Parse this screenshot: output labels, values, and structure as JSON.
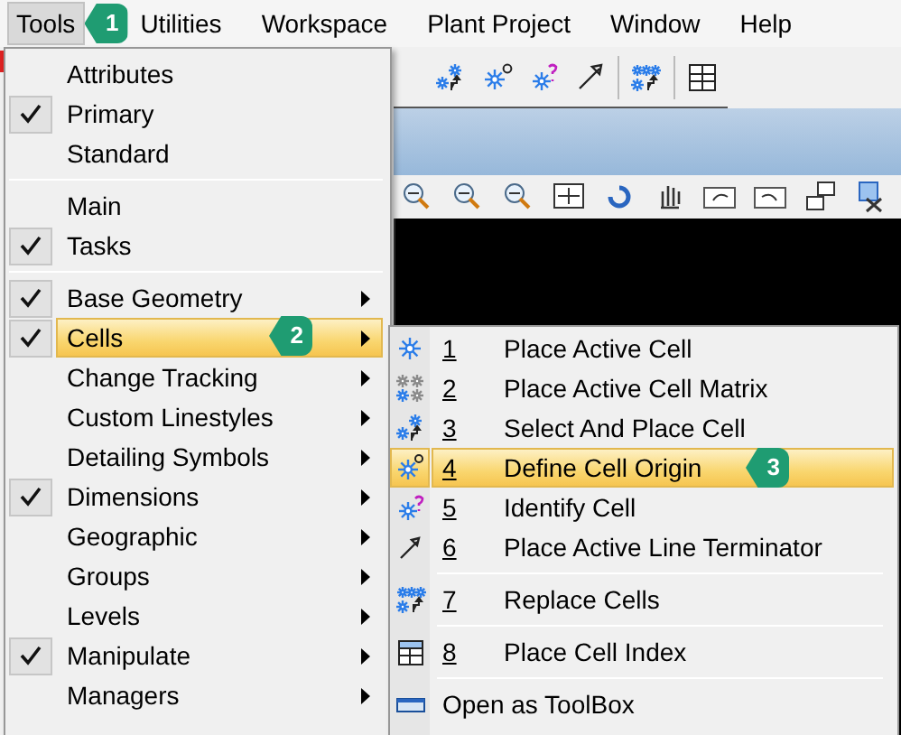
{
  "menubar": {
    "items": [
      {
        "label": "Tools",
        "selected": true,
        "callout": "1"
      },
      {
        "label": "Utilities",
        "selected": false
      },
      {
        "label": "Workspace",
        "selected": false
      },
      {
        "label": "Plant Project",
        "selected": false
      },
      {
        "label": "Window",
        "selected": false
      },
      {
        "label": "Help",
        "selected": false
      }
    ]
  },
  "tools_menu": {
    "sections": [
      [
        {
          "label": "Attributes",
          "checked": false,
          "submenu": false,
          "selected": false
        },
        {
          "label": "Primary",
          "checked": true,
          "submenu": false,
          "selected": false
        },
        {
          "label": "Standard",
          "checked": false,
          "submenu": false,
          "selected": false
        }
      ],
      [
        {
          "label": "Main",
          "checked": false,
          "submenu": false,
          "selected": false
        },
        {
          "label": "Tasks",
          "checked": true,
          "submenu": false,
          "selected": false
        }
      ],
      [
        {
          "label": "Base Geometry",
          "checked": true,
          "submenu": true,
          "selected": false
        },
        {
          "label": "Cells",
          "checked": true,
          "submenu": true,
          "selected": true,
          "callout": "2"
        },
        {
          "label": "Change Tracking",
          "checked": false,
          "submenu": true,
          "selected": false
        },
        {
          "label": "Custom Linestyles",
          "checked": false,
          "submenu": true,
          "selected": false
        },
        {
          "label": "Detailing Symbols",
          "checked": false,
          "submenu": true,
          "selected": false
        },
        {
          "label": "Dimensions",
          "checked": true,
          "submenu": true,
          "selected": false
        },
        {
          "label": "Geographic",
          "checked": false,
          "submenu": true,
          "selected": false
        },
        {
          "label": "Groups",
          "checked": false,
          "submenu": true,
          "selected": false
        },
        {
          "label": "Levels",
          "checked": false,
          "submenu": true,
          "selected": false
        },
        {
          "label": "Manipulate",
          "checked": true,
          "submenu": true,
          "selected": false
        },
        {
          "label": "Managers",
          "checked": false,
          "submenu": true,
          "selected": false
        }
      ]
    ]
  },
  "cells_submenu": {
    "sections": [
      [
        {
          "number": "1",
          "label": "Place Active Cell",
          "selected": false
        },
        {
          "number": "2",
          "label": "Place Active Cell Matrix",
          "selected": false
        },
        {
          "number": "3",
          "label": "Select And Place Cell",
          "selected": false
        },
        {
          "number": "4",
          "label": "Define Cell Origin",
          "selected": true,
          "callout": "3"
        },
        {
          "number": "5",
          "label": "Identify Cell",
          "selected": false
        },
        {
          "number": "6",
          "label": "Place Active Line Terminator",
          "selected": false
        }
      ],
      [
        {
          "number": "7",
          "label": "Replace Cells",
          "selected": false
        }
      ],
      [
        {
          "number": "8",
          "label": "Place Cell Index",
          "selected": false
        }
      ],
      [
        {
          "label": "Open as ToolBox",
          "selected": false
        }
      ]
    ]
  }
}
